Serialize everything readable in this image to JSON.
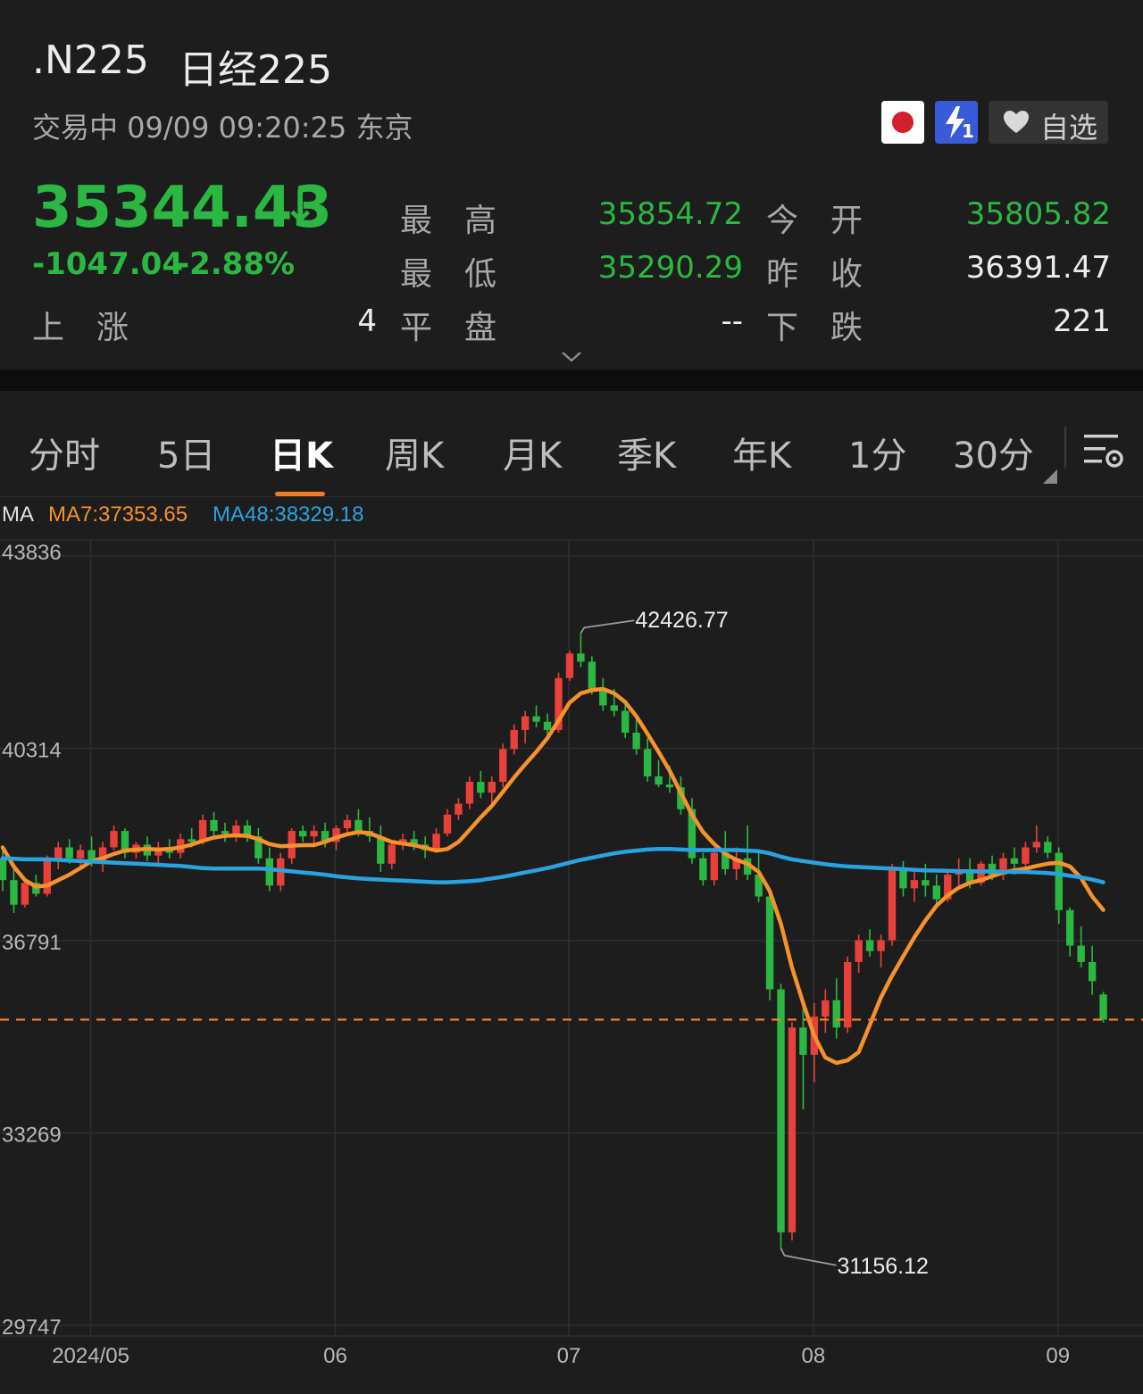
{
  "header": {
    "symbol": ".N225",
    "name": "日经225",
    "status_line": "交易中 09/09 09:20:25 东京",
    "price": "35344.43",
    "price_arrow": "↓",
    "change": "-1047.04",
    "change_pct": "-2.88%",
    "watchlist_label": "自选",
    "badge_level": "1"
  },
  "stats": {
    "high_label": "最　高",
    "high_value": "35854.72",
    "open_label": "今　开",
    "open_value": "35805.82",
    "low_label": "最　低",
    "low_value": "35290.29",
    "prev_close_label": "昨　收",
    "prev_close_value": "36391.47",
    "up_label": "上　涨",
    "up_value": "4",
    "flat_label": "平　盘",
    "flat_value": "--",
    "down_label": "下　跌",
    "down_value": "221"
  },
  "tabs": [
    "分时",
    "5日",
    "日K",
    "周K",
    "月K",
    "季K",
    "年K",
    "1分",
    "30分"
  ],
  "active_tab": "日K",
  "ma": {
    "label": "MA",
    "ma7": "MA7:37353.65",
    "ma48": "MA48:38329.18"
  },
  "colors": {
    "up": "#e8403a",
    "down": "#2bb842",
    "ma7": "#f5922c",
    "ma48": "#29a3e0",
    "price_line": "#f47b20"
  },
  "chart_data": {
    "type": "candlestick",
    "ylim": [
      29747,
      43836
    ],
    "y_ticks": [
      "43836",
      "40314",
      "36791",
      "33269",
      "29747"
    ],
    "x_ticks": [
      "2024/05",
      "06",
      "07",
      "08",
      "09"
    ],
    "max_label": "42426.77",
    "min_label": "31156.12",
    "current_price": 35344.43,
    "candles": [
      [
        38300,
        38500,
        37700,
        37900
      ],
      [
        37900,
        38100,
        37300,
        37450
      ],
      [
        37450,
        37900,
        37400,
        37850
      ],
      [
        37850,
        38000,
        37600,
        37650
      ],
      [
        37650,
        38350,
        37600,
        38250
      ],
      [
        38250,
        38600,
        38100,
        38500
      ],
      [
        38500,
        38650,
        38200,
        38300
      ],
      [
        38300,
        38550,
        38100,
        38450
      ],
      [
        38450,
        38700,
        38150,
        38250
      ],
      [
        38250,
        38600,
        38050,
        38500
      ],
      [
        38500,
        38900,
        38450,
        38800
      ],
      [
        38800,
        38850,
        38300,
        38400
      ],
      [
        38400,
        38600,
        38300,
        38550
      ],
      [
        38550,
        38700,
        38250,
        38350
      ],
      [
        38350,
        38600,
        38200,
        38500
      ],
      [
        38500,
        38650,
        38300,
        38400
      ],
      [
        38400,
        38750,
        38300,
        38650
      ],
      [
        38650,
        38850,
        38500,
        38600
      ],
      [
        38600,
        39100,
        38550,
        39000
      ],
      [
        39000,
        39150,
        38700,
        38800
      ],
      [
        38800,
        38950,
        38600,
        38750
      ],
      [
        38750,
        39000,
        38600,
        38900
      ],
      [
        38900,
        39000,
        38600,
        38700
      ],
      [
        38700,
        38850,
        38200,
        38300
      ],
      [
        38300,
        38500,
        37700,
        37800
      ],
      [
        37800,
        38400,
        37700,
        38300
      ],
      [
        38300,
        38850,
        38200,
        38800
      ],
      [
        38800,
        38900,
        38600,
        38700
      ],
      [
        38700,
        38900,
        38550,
        38800
      ],
      [
        38800,
        38950,
        38500,
        38600
      ],
      [
        38600,
        38900,
        38450,
        38850
      ],
      [
        38850,
        39100,
        38750,
        39000
      ],
      [
        39000,
        39200,
        38700,
        38800
      ],
      [
        38800,
        39050,
        38600,
        38700
      ],
      [
        38700,
        38900,
        38050,
        38200
      ],
      [
        38200,
        38600,
        38100,
        38550
      ],
      [
        38550,
        38750,
        38450,
        38650
      ],
      [
        38650,
        38800,
        38450,
        38550
      ],
      [
        38550,
        38700,
        38300,
        38450
      ],
      [
        38450,
        38850,
        38400,
        38750
      ],
      [
        38750,
        39200,
        38700,
        39100
      ],
      [
        39100,
        39400,
        39000,
        39300
      ],
      [
        39300,
        39800,
        39200,
        39700
      ],
      [
        39700,
        39900,
        39400,
        39500
      ],
      [
        39500,
        39800,
        39300,
        39700
      ],
      [
        39700,
        40400,
        39600,
        40300
      ],
      [
        40300,
        40750,
        40200,
        40650
      ],
      [
        40650,
        41000,
        40400,
        40900
      ],
      [
        40900,
        41100,
        40700,
        40800
      ],
      [
        40800,
        40950,
        40500,
        40650
      ],
      [
        40650,
        41700,
        40600,
        41600
      ],
      [
        41600,
        42100,
        41550,
        42050
      ],
      [
        42050,
        42426.77,
        41800,
        41900
      ],
      [
        41900,
        42000,
        41300,
        41400
      ],
      [
        41400,
        41600,
        41000,
        41100
      ],
      [
        41100,
        41400,
        40900,
        41000
      ],
      [
        41000,
        41150,
        40500,
        40600
      ],
      [
        40600,
        40900,
        40200,
        40300
      ],
      [
        40300,
        40500,
        39700,
        39800
      ],
      [
        39800,
        40100,
        39600,
        39650
      ],
      [
        39650,
        40000,
        39500,
        39600
      ],
      [
        39600,
        39800,
        39100,
        39200
      ],
      [
        39200,
        39400,
        38200,
        38300
      ],
      [
        38300,
        38400,
        37800,
        37900
      ],
      [
        37900,
        38500,
        37800,
        38400
      ],
      [
        38400,
        38800,
        38000,
        38100
      ],
      [
        38100,
        38500,
        37900,
        38300
      ],
      [
        38300,
        38900,
        37900,
        38000
      ],
      [
        38000,
        38400,
        37500,
        37600
      ],
      [
        37600,
        37650,
        35700,
        35900
      ],
      [
        35900,
        36000,
        31156.12,
        31450
      ],
      [
        31450,
        35300,
        31300,
        35200
      ],
      [
        35200,
        35600,
        33700,
        34700
      ],
      [
        34700,
        35650,
        34200,
        35400
      ],
      [
        35400,
        35900,
        35100,
        35700
      ],
      [
        35700,
        36100,
        35000,
        35200
      ],
      [
        35200,
        36500,
        35100,
        36400
      ],
      [
        36400,
        36900,
        36200,
        36800
      ],
      [
        36800,
        37000,
        36500,
        36600
      ],
      [
        36600,
        36900,
        36300,
        36800
      ],
      [
        36800,
        38200,
        36700,
        38100
      ],
      [
        38100,
        38250,
        37600,
        37750
      ],
      [
        37750,
        38100,
        37500,
        37900
      ],
      [
        37900,
        38200,
        37600,
        37800
      ],
      [
        37800,
        38000,
        37400,
        37550
      ],
      [
        37550,
        38100,
        37500,
        38000
      ],
      [
        38000,
        38300,
        37800,
        38100
      ],
      [
        38100,
        38300,
        37750,
        37850
      ],
      [
        37850,
        38250,
        37800,
        38200
      ],
      [
        38200,
        38350,
        37900,
        38000
      ],
      [
        38000,
        38400,
        37900,
        38300
      ],
      [
        38300,
        38500,
        38000,
        38200
      ],
      [
        38200,
        38600,
        38050,
        38500
      ],
      [
        38500,
        38900,
        38400,
        38600
      ],
      [
        38600,
        38700,
        38300,
        38400
      ],
      [
        38400,
        38500,
        37100,
        37350
      ],
      [
        37350,
        37400,
        36500,
        36700
      ],
      [
        36700,
        37050,
        36300,
        36400
      ],
      [
        36400,
        36700,
        35800,
        36050
      ],
      [
        35805.82,
        35854.72,
        35290.29,
        35344.43
      ]
    ],
    "series": [
      {
        "name": "MA7",
        "values": [
          38500,
          38150,
          37900,
          37780,
          37800,
          37900,
          38000,
          38120,
          38250,
          38300,
          38380,
          38440,
          38460,
          38470,
          38460,
          38470,
          38500,
          38550,
          38620,
          38680,
          38710,
          38720,
          38710,
          38650,
          38560,
          38520,
          38530,
          38540,
          38540,
          38600,
          38680,
          38740,
          38780,
          38760,
          38680,
          38600,
          38570,
          38540,
          38490,
          38440,
          38470,
          38600,
          38820,
          39050,
          39260,
          39520,
          39780,
          40020,
          40250,
          40500,
          40820,
          41150,
          41320,
          41380,
          41400,
          41320,
          41160,
          40900,
          40580,
          40250,
          39900,
          39500,
          39100,
          38780,
          38560,
          38380,
          38270,
          38200,
          38050,
          37700,
          37100,
          36300,
          35650,
          35050,
          34650,
          34550,
          34600,
          34750,
          35250,
          35750,
          36150,
          36500,
          36850,
          37160,
          37430,
          37620,
          37760,
          37850,
          37900,
          37970,
          38040,
          38080,
          38110,
          38160,
          38200,
          38220,
          38150,
          37940,
          37600,
          37353.65
        ]
      },
      {
        "name": "MA48",
        "values": [
          38300,
          38290,
          38280,
          38280,
          38280,
          38270,
          38260,
          38250,
          38240,
          38230,
          38220,
          38210,
          38200,
          38190,
          38180,
          38170,
          38160,
          38140,
          38120,
          38110,
          38110,
          38110,
          38110,
          38110,
          38100,
          38080,
          38060,
          38040,
          38020,
          38000,
          37970,
          37950,
          37930,
          37920,
          37910,
          37900,
          37890,
          37880,
          37870,
          37860,
          37860,
          37870,
          37880,
          37900,
          37930,
          37960,
          38000,
          38040,
          38080,
          38120,
          38170,
          38220,
          38270,
          38310,
          38350,
          38390,
          38420,
          38440,
          38460,
          38470,
          38470,
          38460,
          38450,
          38450,
          38450,
          38450,
          38450,
          38440,
          38430,
          38390,
          38330,
          38280,
          38250,
          38220,
          38190,
          38170,
          38150,
          38140,
          38130,
          38120,
          38110,
          38100,
          38090,
          38080,
          38075,
          38070,
          38065,
          38060,
          38060,
          38060,
          38055,
          38050,
          38050,
          38040,
          38030,
          38010,
          37980,
          37950,
          37910,
          37860
        ]
      }
    ]
  }
}
